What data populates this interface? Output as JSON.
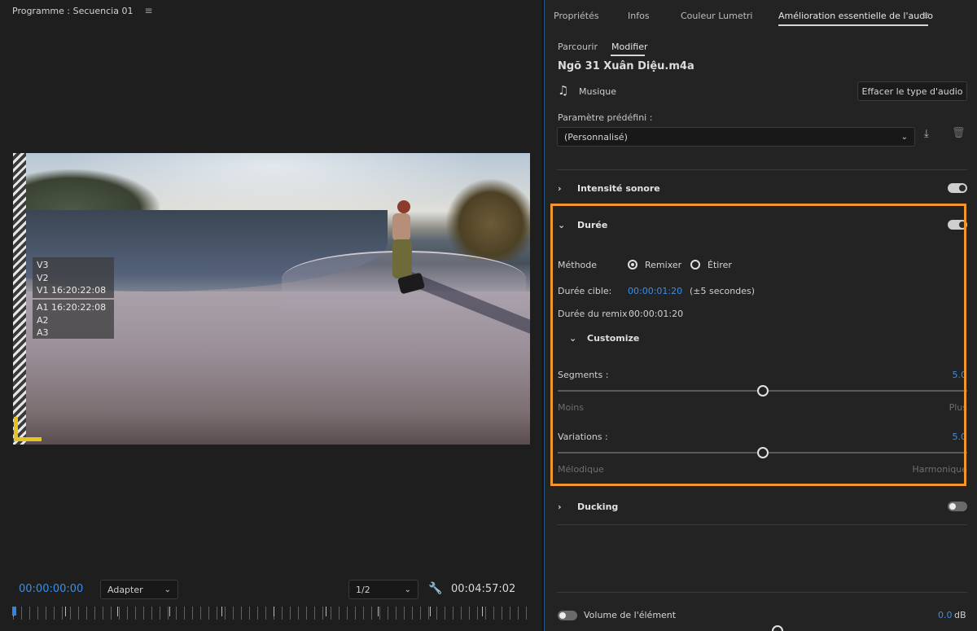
{
  "monitor": {
    "title": "Programme : Secuencia 01",
    "menu_icon": "hamburger-menu-icon",
    "tracks_video": [
      "V3",
      "V2",
      "V1 16:20:22:08"
    ],
    "tracks_audio": [
      "A1 16:20:22:08",
      "A2",
      "A3"
    ],
    "timecode_current": "00:00:00:00",
    "fit_dropdown": "Adapter",
    "resolution_dropdown": "1/2",
    "settings_icon": "wrench-icon",
    "timecode_duration": "00:04:57:02"
  },
  "panel": {
    "tabs": [
      {
        "label": "Propriétés"
      },
      {
        "label": "Infos"
      },
      {
        "label": "Couleur Lumetri"
      },
      {
        "label": "Amélioration essentielle de l'audio"
      }
    ],
    "subtabs": [
      {
        "label": "Parcourir"
      },
      {
        "label": "Modifier"
      }
    ],
    "clip_name": "Ngõ 31 Xuân Diệu.m4a",
    "audio_type": "Musique",
    "clear_button": "Effacer le type d'audio",
    "preset_label": "Paramètre prédéfini :",
    "preset_value": "(Personnalisé)",
    "sections": {
      "loudness": {
        "title": "Intensité sonore",
        "enabled": true
      },
      "duration": {
        "title": "Durée",
        "enabled": true
      },
      "ducking": {
        "title": "Ducking",
        "enabled": false
      }
    },
    "duration": {
      "method_label": "Méthode",
      "method_options": [
        "Remixer",
        "Étirer"
      ],
      "method_selected": "Remixer",
      "target_label": "Durée cible:",
      "target_value": "00:00:01:20",
      "target_hint": "(±5 secondes)",
      "remix_label": "Durée du remix :",
      "remix_value": "00:00:01:20",
      "customize_title": "Customize",
      "segments": {
        "label": "Segments :",
        "value": "5.0",
        "min_label": "Moins",
        "max_label": "Plus",
        "fraction": 0.5
      },
      "variations": {
        "label": "Variations :",
        "value": "5.0",
        "min_label": "Mélodique",
        "max_label": "Harmonique",
        "fraction": 0.5
      }
    },
    "volume": {
      "label": "Volume de l'élément",
      "value": "0.0",
      "unit": "dB",
      "enabled": false
    },
    "highlight_color": "#f0962a",
    "accent_color": "#3b8fe8"
  }
}
